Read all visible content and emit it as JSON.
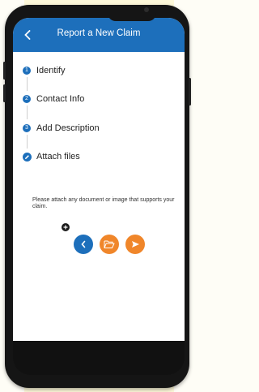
{
  "header": {
    "title": "Report a New Claim",
    "back_icon": "chevron-left-icon"
  },
  "steps": [
    {
      "number": "1",
      "label": "Identify"
    },
    {
      "number": "2",
      "label": "Contact Info"
    },
    {
      "number": "3",
      "label": "Add Description"
    },
    {
      "number": "",
      "icon": "pencil-icon",
      "label": "Attach files"
    }
  ],
  "attach": {
    "instructions": "Please attach any document or image that supports your claim.",
    "add_icon": "plus-icon"
  },
  "actions": {
    "back_icon": "chevron-left-icon",
    "folder_icon": "folder-open-icon",
    "send_icon": "send-icon"
  },
  "colors": {
    "primary": "#1d6fbb",
    "accent": "#f0862a",
    "device": "#151515"
  }
}
